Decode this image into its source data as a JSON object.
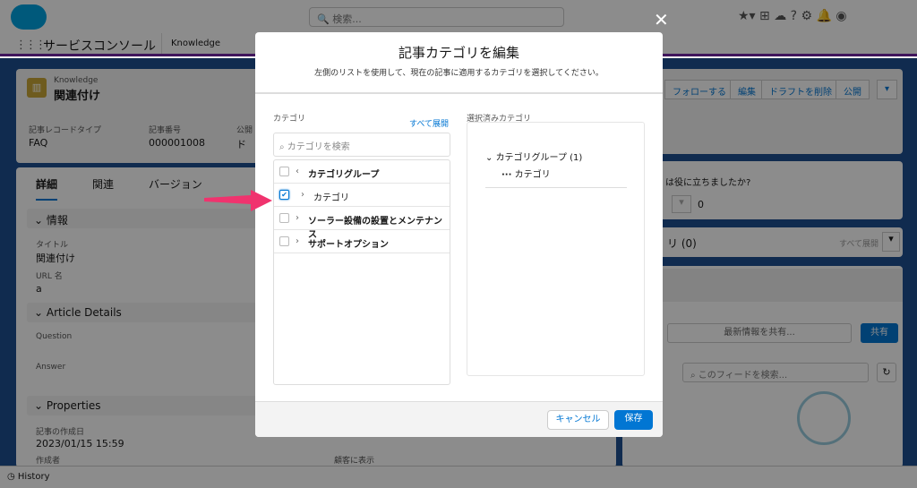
{
  "header": {
    "search_placeholder": "検索...",
    "app_name": "サービスコンソール",
    "tab": "Knowledge"
  },
  "record": {
    "type": "Knowledge",
    "title": "関連付け",
    "fields": [
      {
        "label": "記事レコードタイプ",
        "value": "FAQ"
      },
      {
        "label": "記事番号",
        "value": "000001008"
      },
      {
        "label": "公開",
        "value": "ド"
      }
    ],
    "actions": [
      "フォローする",
      "編集",
      "ドラフトを削除",
      "公開"
    ]
  },
  "tabs": [
    "詳細",
    "関連",
    "バージョン"
  ],
  "sections": {
    "info": "情報",
    "title_label": "タイトル",
    "title_value": "関連付け",
    "url_label": "URL 名",
    "url_value": "a",
    "article": "Article Details",
    "question": "Question",
    "answer": "Answer",
    "props": "Properties",
    "created_label": "記事の作成日",
    "created_value": "2023/01/15 15:59",
    "creator_label": "作成者",
    "visible_label": "顧客に表示"
  },
  "right": {
    "helpful": "は役に立ちましたか?",
    "votes": "0",
    "categories": "リ (0)",
    "expand_all": "すべて展開",
    "share_placeholder": "最新情報を共有...",
    "share": "共有",
    "feed_search": "このフィードを検索..."
  },
  "footer": {
    "history": "History"
  },
  "modal": {
    "title": "記事カテゴリを編集",
    "subtitle": "左側のリストを使用して、現在の記事に適用するカテゴリを選択してください。",
    "category_label": "カテゴリ",
    "expand_all": "すべて展開",
    "search_placeholder": "カテゴリを検索",
    "selected_label": "選択済みカテゴリ",
    "items": [
      {
        "label": "カテゴリグループ",
        "checked": false,
        "bold": true,
        "chevron": "left"
      },
      {
        "label": "カテゴリ",
        "checked": true,
        "bold": false,
        "chevron": "right"
      },
      {
        "label": "ソーラー設備の設置とメンテナンス",
        "checked": false,
        "bold": true,
        "chevron": "right"
      },
      {
        "label": "サポートオプション",
        "checked": false,
        "bold": true,
        "chevron": "right"
      }
    ],
    "selected_group": "カテゴリグループ (1)",
    "selected_item": "カテゴリ",
    "cancel": "キャンセル",
    "save": "保存"
  },
  "colors": {
    "brand": "#0176d3",
    "annotation_arrow": "#f0336e"
  }
}
